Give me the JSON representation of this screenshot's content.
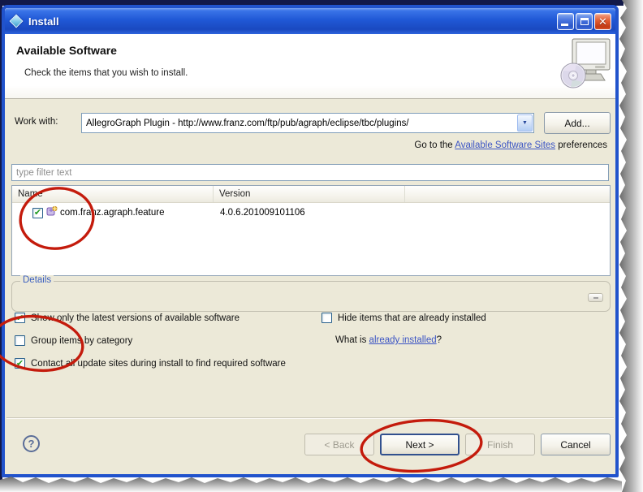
{
  "window": {
    "title": "Install",
    "close_glyph": "✕"
  },
  "header": {
    "title": "Available Software",
    "subtitle": "Check the items that you wish to install."
  },
  "work_with": {
    "label": "Work with:",
    "value": "AllegroGraph Plugin - http://www.franz.com/ftp/pub/agraph/eclipse/tbc/plugins/",
    "combo_arrow": "▼",
    "add_button": "Add...",
    "sites_prefix": "Go to the ",
    "sites_link": "Available Software Sites",
    "sites_suffix": " preferences"
  },
  "filter": {
    "placeholder": "type filter text"
  },
  "table": {
    "columns": {
      "name": "Name",
      "version": "Version"
    },
    "rows": [
      {
        "check": "✔",
        "name": "com.franz.agraph.feature",
        "version": "4.0.6.201009101106"
      }
    ]
  },
  "details": {
    "label": "Details"
  },
  "options": {
    "latest": {
      "label": "Show only the latest versions of available software",
      "check": "✔"
    },
    "hide_installed": {
      "label": "Hide items that are already installed",
      "check": ""
    },
    "group": {
      "label": "Group items by category",
      "check": ""
    },
    "contact": {
      "label": "Contact all update sites during install to find required software",
      "check": "✔"
    },
    "what_is_prefix": "What is ",
    "what_is_link": "already installed",
    "what_is_suffix": "?"
  },
  "footer": {
    "help": "?",
    "back": "< Back",
    "next": "Next >",
    "finish": "Finish",
    "cancel": "Cancel"
  },
  "colors": {
    "titlebar_blue": "#2058d6",
    "window_border": "#2153cc",
    "dialog_bg": "#ece9d8",
    "link_blue": "#3c55c4",
    "annotation_red": "#c41b0c",
    "check_green": "#219a21"
  }
}
